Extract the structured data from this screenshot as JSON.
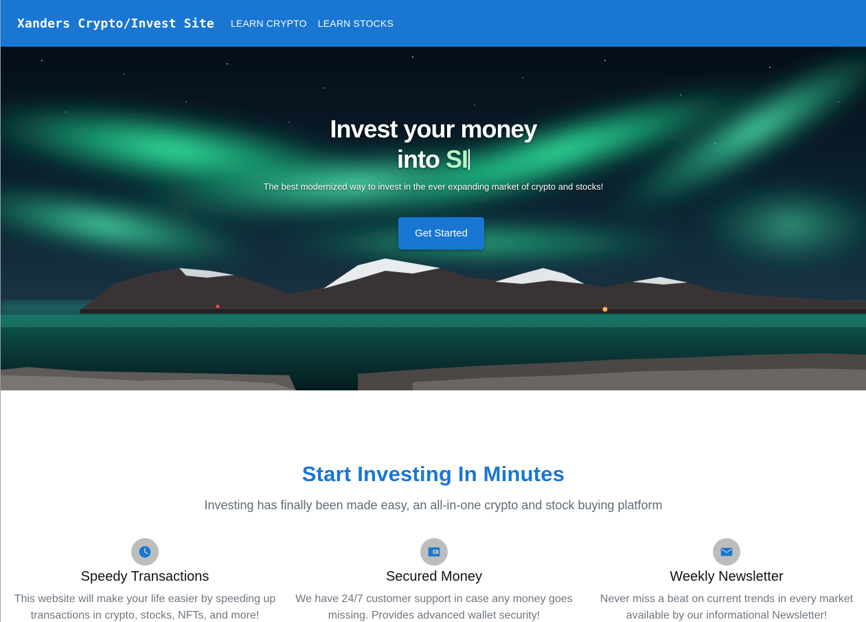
{
  "navbar": {
    "brand": "Xanders Crypto/Invest Site",
    "links": [
      "LEARN CRYPTO",
      "LEARN STOCKS"
    ]
  },
  "hero": {
    "title_line1": "Invest your money",
    "title_line2_prefix": "into",
    "typed_text": "SI",
    "subtitle": "The best modernized way to invest in the ever expanding market of crypto and stocks!",
    "cta_label": "Get Started"
  },
  "features_section": {
    "title": "Start Investing In Minutes",
    "subtitle": "Investing has finally been made easy, an all-in-one crypto and stock buying platform",
    "items": [
      {
        "icon": "clock-icon",
        "title": "Speedy Transactions",
        "text": "This website will make your life easier by speeding up transactions in crypto, stocks, NFTs, and more!"
      },
      {
        "icon": "wallet-icon",
        "title": "Secured Money",
        "text": "We have 24/7 customer support in case any money goes missing. Provides advanced wallet security!"
      },
      {
        "icon": "mail-icon",
        "title": "Weekly Newsletter",
        "text": "Never miss a beat on current trends in every market available by our informational Newsletter!"
      }
    ]
  },
  "colors": {
    "primary": "#1976d2",
    "icon_bg": "#bdbdbd",
    "muted_text": "#6c7680",
    "aurora": "#1ee89a"
  }
}
